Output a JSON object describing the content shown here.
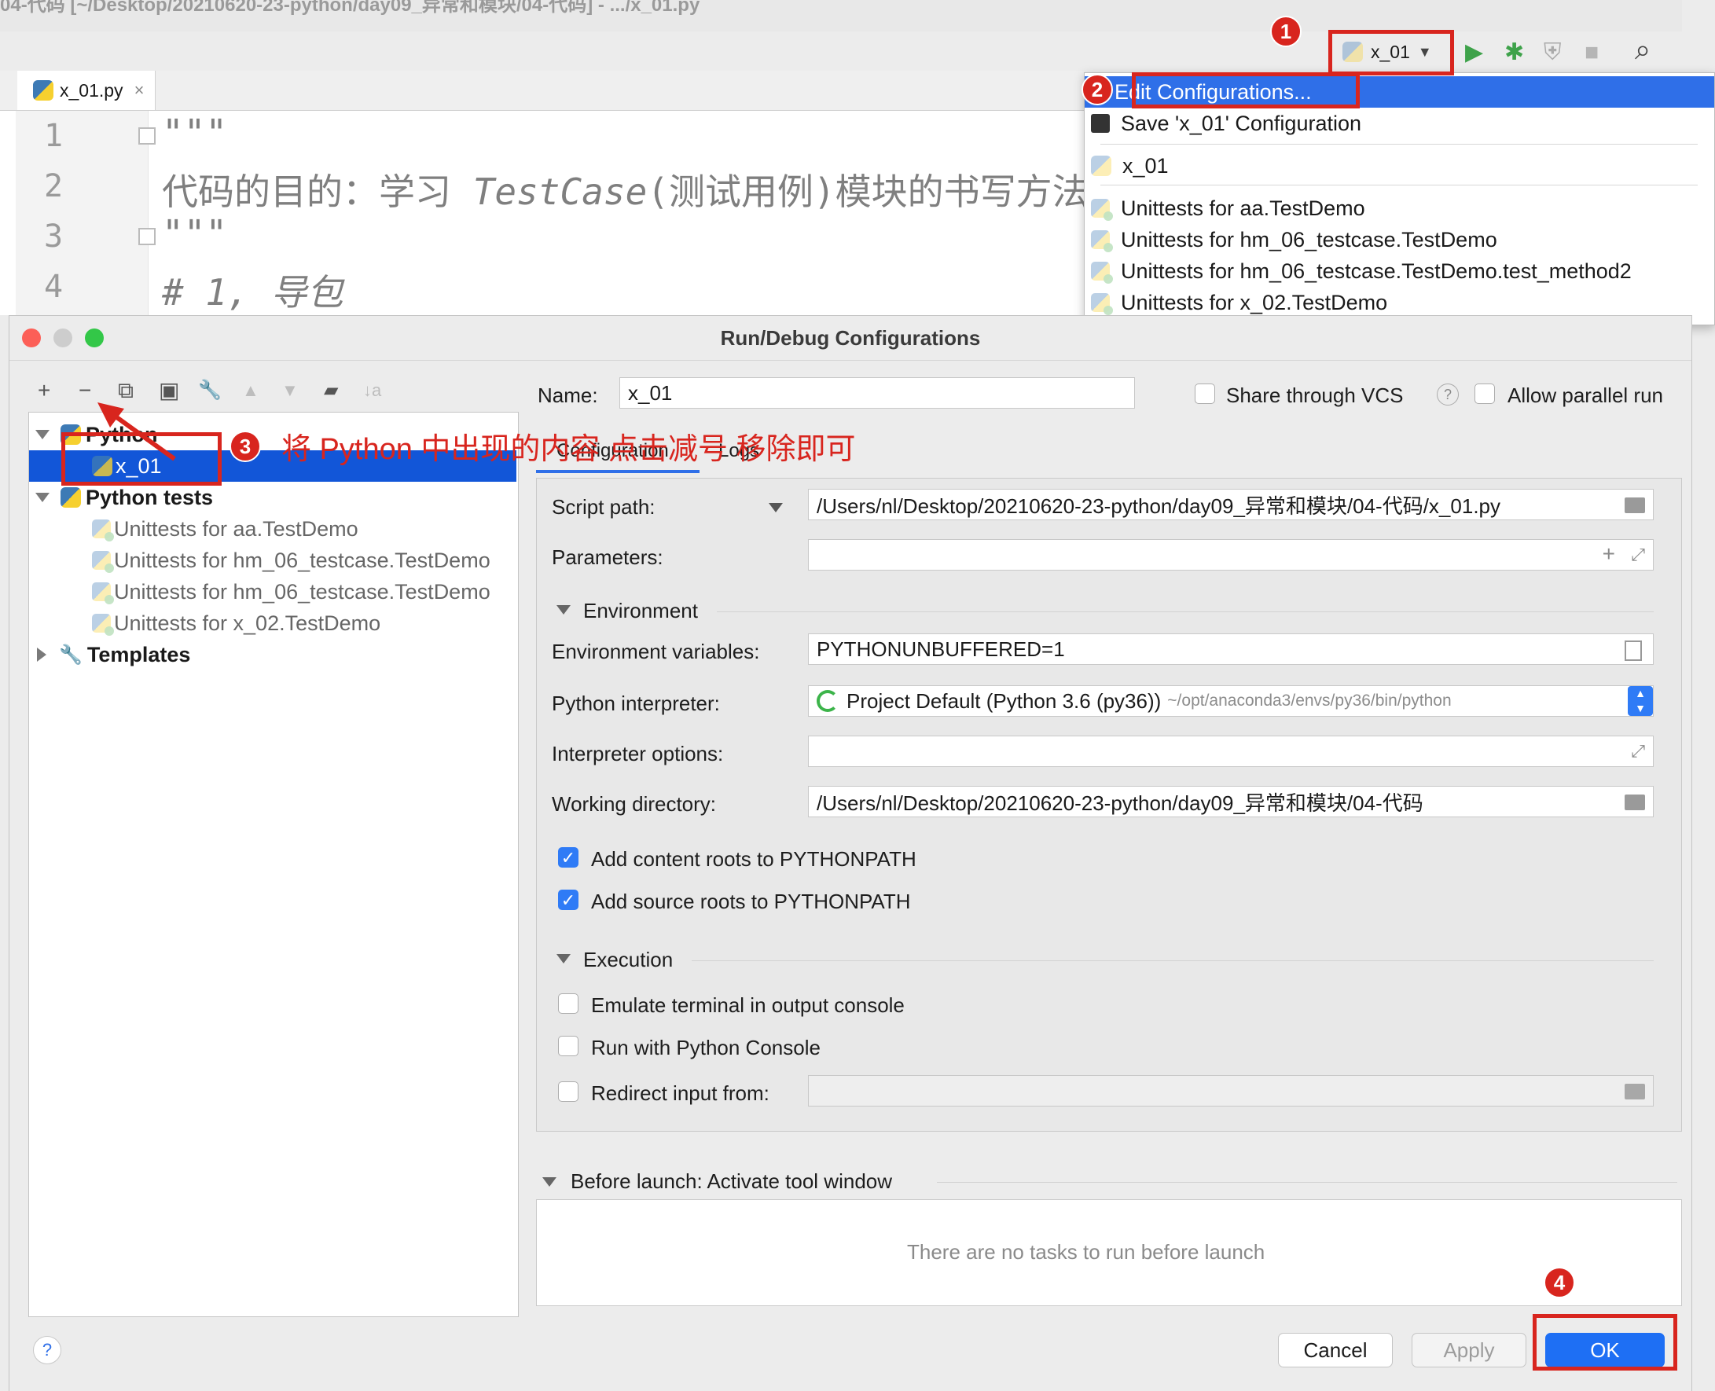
{
  "ide": {
    "window_title": "04-代码 [~/Desktop/20210620-23-python/day09_异常和模块/04-代码] - .../x_01.py",
    "file_tab": "x_01.py",
    "file_tab_close": "×",
    "code_lines": [
      {
        "num": "1",
        "text": "\"\"\""
      },
      {
        "num": "2",
        "text_a": "代码的目的：学习 ",
        "text_b": "TestCase",
        "text_c": "(测试用例)模块的书写方法"
      },
      {
        "num": "3",
        "text": "\"\"\""
      },
      {
        "num": "4",
        "text": "# 1, 导包"
      }
    ]
  },
  "run_toolbar": {
    "config_name": "x_01",
    "icons": [
      "run-icon",
      "debug-icon",
      "coverage-icon",
      "stop-icon",
      "search-icon"
    ],
    "glyphs": {
      "run": "▶",
      "debug": "✱",
      "coverage": "⛨",
      "stop": "■",
      "search": "⌕",
      "dropdown": "▼"
    }
  },
  "config_popup": {
    "edit": "Edit Configurations...",
    "save": "Save 'x_01' Configuration",
    "items": [
      "x_01",
      "Unittests for aa.TestDemo",
      "Unittests for hm_06_testcase.TestDemo",
      "Unittests for hm_06_testcase.TestDemo.test_method2",
      "Unittests for x_02.TestDemo"
    ]
  },
  "dialog": {
    "title": "Run/Debug Configurations",
    "toolbar": {
      "add": "+",
      "remove": "−",
      "copy": "⧉",
      "save": "▣",
      "wrench": "🔧",
      "up": "▲",
      "down": "▼",
      "folder": "▰",
      "sort": "↓a"
    },
    "tree": {
      "python": "Python",
      "x_01": "x_01",
      "python_tests": "Python tests",
      "tests": [
        "Unittests for aa.TestDemo",
        "Unittests for hm_06_testcase.TestDemo",
        "Unittests for hm_06_testcase.TestDemo",
        "Unittests for x_02.TestDemo"
      ],
      "templates": "Templates"
    },
    "name_label": "Name:",
    "name_value": "x_01",
    "share_vcs": "Share through VCS",
    "help_mark": "?",
    "allow_parallel": "Allow parallel run",
    "tabs": [
      "Configuration",
      "Logs"
    ],
    "script_path_label": "Script path:",
    "script_path": "/Users/nl/Desktop/20210620-23-python/day09_异常和模块/04-代码/x_01.py",
    "parameters_label": "Parameters:",
    "parameters_value": "",
    "environment_section": "Environment",
    "env_vars_label": "Environment variables:",
    "env_vars": "PYTHONUNBUFFERED=1",
    "interpreter_label": "Python interpreter:",
    "interpreter": "Project Default (Python 3.6 (py36))",
    "interpreter_path": "~/opt/anaconda3/envs/py36/bin/python",
    "interp_options_label": "Interpreter options:",
    "interp_options_value": "",
    "workdir_label": "Working directory:",
    "workdir": "/Users/nl/Desktop/20210620-23-python/day09_异常和模块/04-代码",
    "add_content_roots": "Add content roots to PYTHONPATH",
    "add_source_roots": "Add source roots to PYTHONPATH",
    "execution_section": "Execution",
    "emulate_terminal": "Emulate terminal in output console",
    "run_with_console": "Run with Python Console",
    "redirect_input": "Redirect input from:",
    "redirect_value": "",
    "before_launch": "Before launch: Activate tool window",
    "no_tasks": "There are no tasks to run before launch",
    "help": "?",
    "cancel": "Cancel",
    "apply": "Apply",
    "ok": "OK"
  },
  "annotations": {
    "badges": [
      "1",
      "2",
      "3",
      "4"
    ],
    "instruction": "将 Python 中出现的内容 点击减号 移除即可",
    "color": "#d8251e"
  },
  "colors": {
    "selection": "#1256d8",
    "menu_highlight": "#2f6fe8",
    "ok_button": "#1e6ff4",
    "annotation": "#d8251e"
  }
}
